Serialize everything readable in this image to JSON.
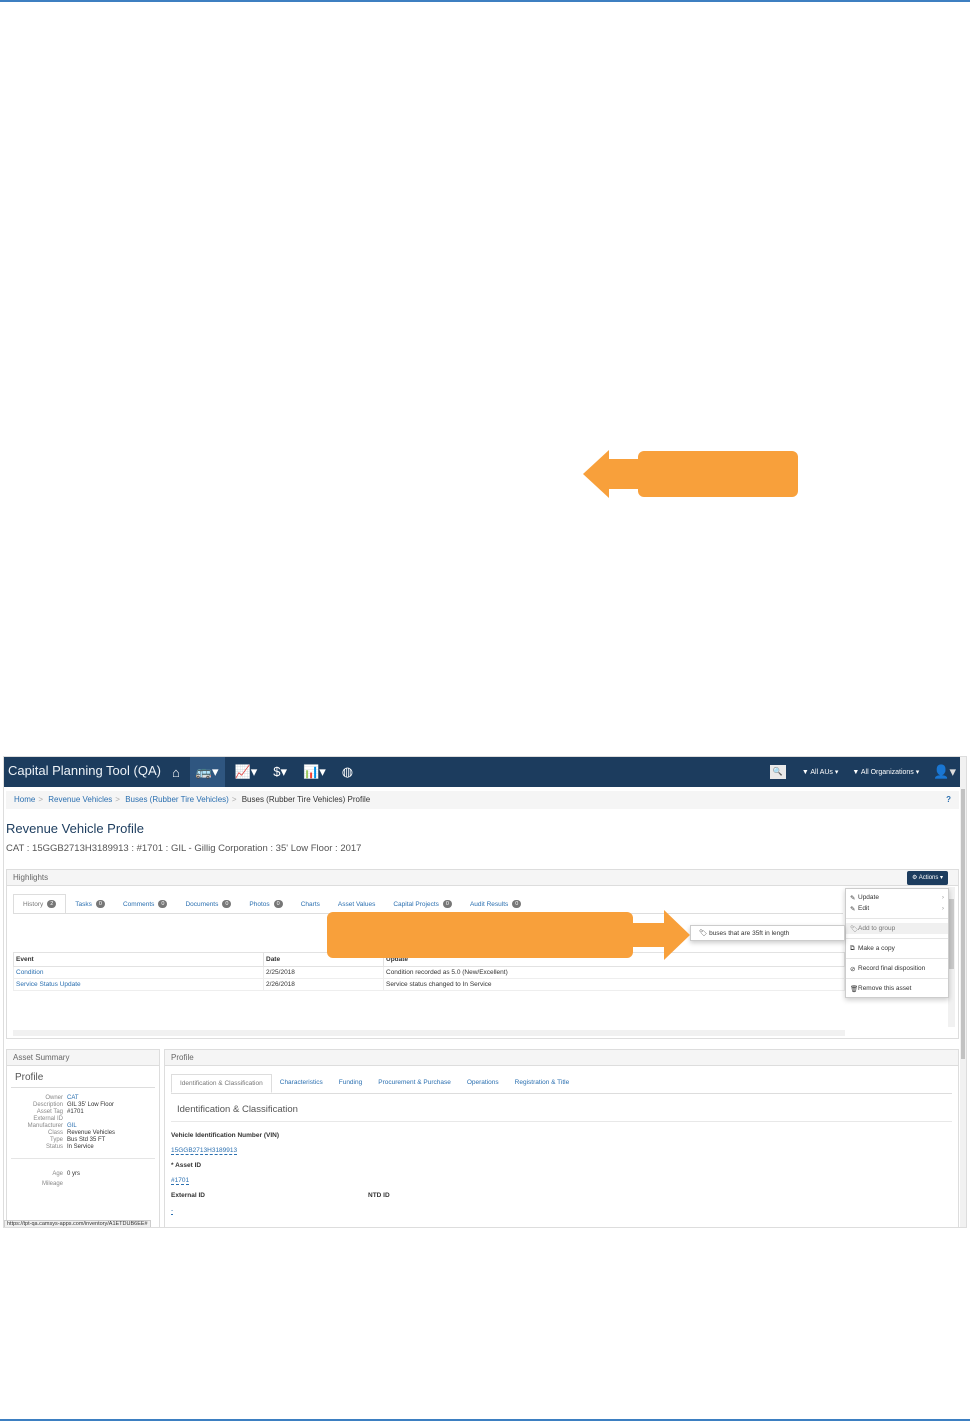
{
  "colors": {
    "accent": "#f8a03b",
    "navbar": "#1c3c5e",
    "link": "#2a6fb0",
    "rule": "#3d7fc1"
  },
  "navbar": {
    "brand": "Capital Planning Tool (QA)",
    "icons": [
      {
        "name": "home-icon",
        "glyph": "⌂"
      },
      {
        "name": "bus-icon",
        "glyph": "🚌▾"
      },
      {
        "name": "line-chart-icon",
        "glyph": "📈▾"
      },
      {
        "name": "dollar-icon",
        "glyph": "$▾"
      },
      {
        "name": "bar-chart-icon",
        "glyph": "📊▾"
      },
      {
        "name": "globe-icon",
        "glyph": "◍"
      }
    ],
    "search_glyph": "🔍",
    "filter_agencies": "All AUs",
    "filter_orgs": "All Organizations",
    "user_glyph": "👤▾"
  },
  "breadcrumb": {
    "home": "Home",
    "revenue_vehicles": "Revenue Vehicles",
    "buses": "Buses (Rubber Tire Vehicles)",
    "current": "Buses (Rubber Tire Vehicles) Profile",
    "separator": ">",
    "help": "?"
  },
  "page": {
    "title": "Revenue Vehicle Profile",
    "subtitle": "CAT : 15GGB2713H3189913 : #1701 : GIL - Gillig Corporation : 35' Low Floor : 2017"
  },
  "highlights": {
    "heading": "Highlights",
    "actions_label": "⚙ Actions ▾",
    "tabs": [
      {
        "label": "History",
        "badge": "2"
      },
      {
        "label": "Tasks",
        "badge": "0"
      },
      {
        "label": "Comments",
        "badge": "0"
      },
      {
        "label": "Documents",
        "badge": "0"
      },
      {
        "label": "Photos",
        "badge": "0"
      },
      {
        "label": "Charts",
        "badge": ""
      },
      {
        "label": "Asset Values",
        "badge": ""
      },
      {
        "label": "Capital Projects",
        "badge": "0"
      },
      {
        "label": "Audit Results",
        "badge": "0"
      }
    ],
    "columns": [
      "Event",
      "Date",
      "Update"
    ],
    "rows": [
      [
        "Condition",
        "2/25/2018",
        "Condition recorded as 5.0 (New/Excellent)"
      ],
      [
        "Service Status Update",
        "2/26/2018",
        "Service status changed to In Service"
      ]
    ]
  },
  "actions_menu": {
    "update": "Update",
    "edit": "Edit",
    "add_to_group": "Add to group",
    "make_copy": "Make a copy",
    "record_disposition": "Record final disposition",
    "remove": "Remove this asset",
    "submenu_item": "buses that are 35ft in length"
  },
  "asset_summary": {
    "heading": "Asset Summary",
    "title": "Profile",
    "fields": [
      {
        "k": "Owner",
        "v": "CAT",
        "link": true
      },
      {
        "k": "Description",
        "v": "GIL 35' Low Floor",
        "link": false
      },
      {
        "k": "Asset Tag",
        "v": "#1701",
        "link": false
      },
      {
        "k": "External ID",
        "v": "",
        "link": false
      },
      {
        "k": "Manufacturer",
        "v": "GIL",
        "link": true
      },
      {
        "k": "Class",
        "v": "Revenue Vehicles",
        "link": false
      },
      {
        "k": "Type",
        "v": "Bus Std 35 FT",
        "link": false
      },
      {
        "k": "Status",
        "v": "In Service",
        "link": false
      }
    ],
    "age_label": "Age",
    "age_value": "0 yrs",
    "mileage_label": "Mileage"
  },
  "profile": {
    "heading": "Profile",
    "tabs": [
      "Identification & Classification",
      "Characteristics",
      "Funding",
      "Procurement & Purchase",
      "Operations",
      "Registration & Title"
    ],
    "section_title": "Identification & Classification",
    "vin_label": "Vehicle Identification Number (VIN)",
    "vin_value": "15GGB2713H3189913",
    "asset_id_label": "* Asset ID",
    "asset_id_value": "#1701",
    "external_id_label": "External ID",
    "external_id_value": "-",
    "ntd_id_label": "NTD ID"
  },
  "status_url": "https://tpt-qa.camsys-apps.com/inventory/A1ETDUB6EE#"
}
